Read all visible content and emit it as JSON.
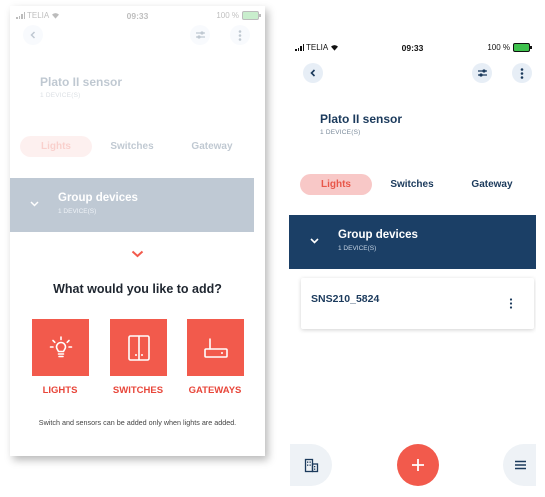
{
  "status_bar": {
    "carrier": "TELIA",
    "time": "09:33",
    "battery": "100 %"
  },
  "header": {
    "title": "Plato II sensor",
    "subtitle": "1 DEVICE(S)"
  },
  "tabs": [
    {
      "label": "Lights",
      "active": true
    },
    {
      "label": "Switches",
      "active": false
    },
    {
      "label": "Gateway",
      "active": false
    }
  ],
  "group": {
    "title": "Group devices",
    "subtitle": "1 DEVICE(S)"
  },
  "add_sheet": {
    "question": "What would you like to add?",
    "options": [
      {
        "label": "LIGHTS",
        "icon": "light-bulb-icon"
      },
      {
        "label": "SWITCHES",
        "icon": "switch-icon"
      },
      {
        "label": "GATEWAYS",
        "icon": "gateway-icon"
      }
    ],
    "note": "Switch and sensors can be added only when lights are added."
  },
  "devices": [
    {
      "name": "SNS210_5824"
    }
  ],
  "colors": {
    "accent": "#f25a4c",
    "navy": "#1b3f66",
    "tab_active_bg": "#f8c8c7",
    "battery": "#3ec14d"
  }
}
